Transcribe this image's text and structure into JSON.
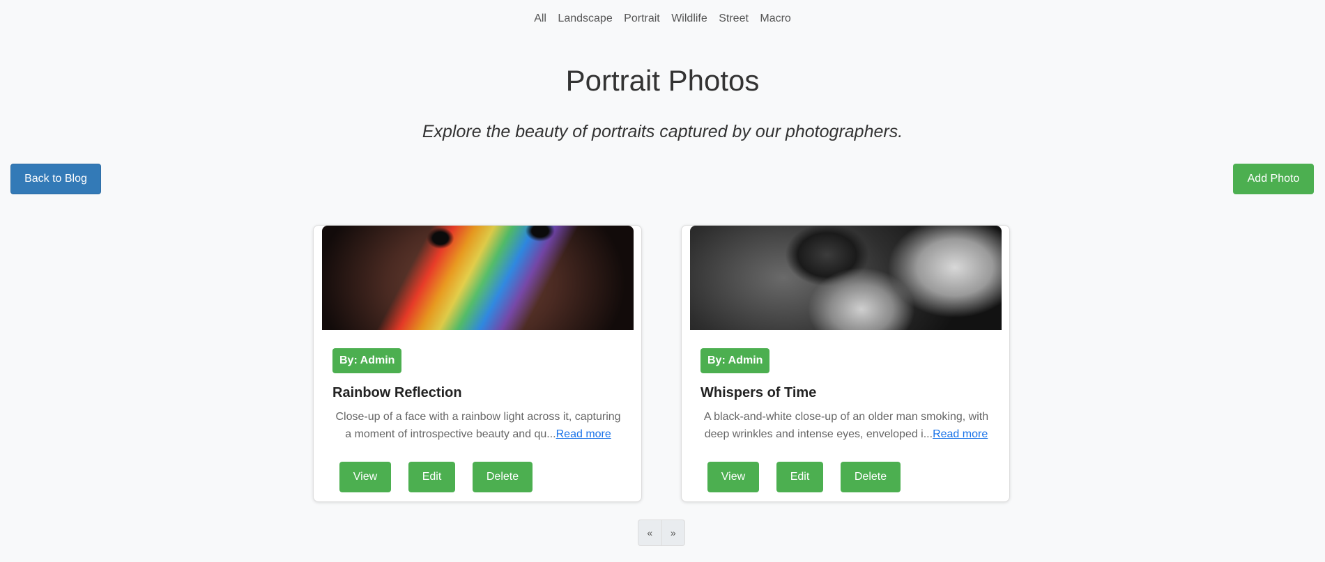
{
  "nav": {
    "categories": [
      "All",
      "Landscape",
      "Portrait",
      "Wildlife",
      "Street",
      "Macro"
    ]
  },
  "header": {
    "title": "Portrait Photos",
    "subtitle": "Explore the beauty of portraits captured by our photographers."
  },
  "actions": {
    "back_label": "Back to Blog",
    "add_label": "Add Photo"
  },
  "colors": {
    "primary_blue": "#337ab7",
    "success_green": "#4caf50",
    "link_blue": "#1a73e8"
  },
  "cards": [
    {
      "author": "By: Admin",
      "title": "Rainbow Reflection",
      "excerpt": "Close-up of a face with a rainbow light across it, capturing a moment of introspective beauty and qu...",
      "read_more": "Read more",
      "view_label": "View",
      "edit_label": "Edit",
      "delete_label": "Delete"
    },
    {
      "author": "By: Admin",
      "title": "Whispers of Time",
      "excerpt": "A black-and-white close-up of an older man smoking, with deep wrinkles and intense eyes, enveloped i...",
      "read_more": "Read more",
      "view_label": "View",
      "edit_label": "Edit",
      "delete_label": "Delete"
    }
  ],
  "pagination": {
    "prev": "«",
    "next": "»"
  }
}
